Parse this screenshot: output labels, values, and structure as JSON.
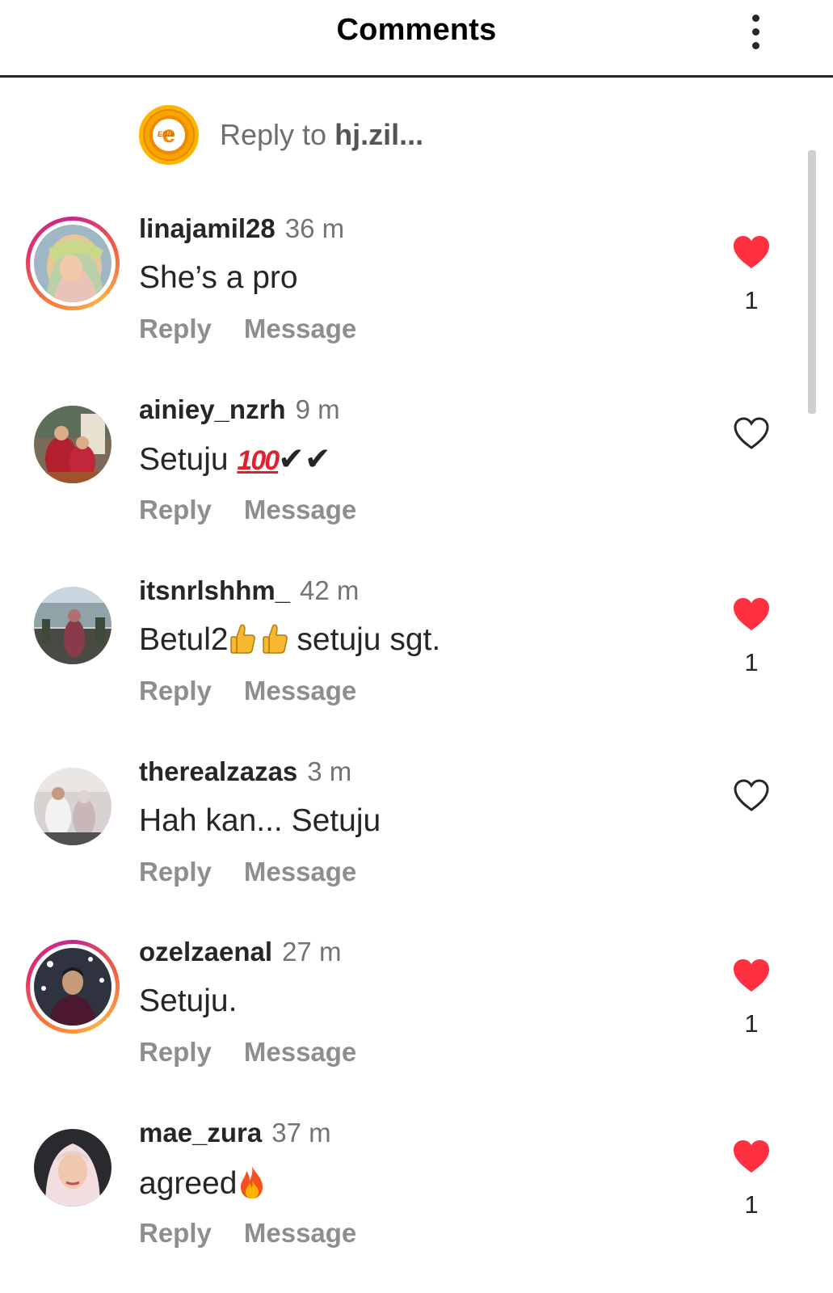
{
  "header": {
    "title": "Comments",
    "more_icon": "more-vertical-icon"
  },
  "reply_bar": {
    "prefix": "Reply to ",
    "username": "hj.zil...",
    "avatar_label": "EDtv"
  },
  "actions": {
    "reply": "Reply",
    "message": "Message"
  },
  "comments": [
    {
      "username": "linajamil28",
      "time": "36 m",
      "text": "She’s a pro",
      "liked": true,
      "like_count": "1",
      "story_ring": true
    },
    {
      "username": "ainiey_nzrh",
      "time": "9 m",
      "text_prefix": "Setuju ",
      "emoji_100": "100",
      "checks": "✔✔",
      "liked": false,
      "story_ring": false
    },
    {
      "username": "itsnrlshhm_",
      "time": "42 m",
      "text_prefix": "Betul2",
      "text_suffix": " setuju sgt.",
      "liked": true,
      "like_count": "1",
      "story_ring": false
    },
    {
      "username": "therealzazas",
      "time": "3 m",
      "text": "Hah kan... Setuju",
      "liked": false,
      "story_ring": false
    },
    {
      "username": "ozelzaenal",
      "time": "27 m",
      "text": "Setuju.",
      "liked": true,
      "like_count": "1",
      "story_ring": true
    },
    {
      "username": "mae_zura",
      "time": "37 m",
      "text_prefix": "agreed",
      "liked": true,
      "like_count": "1",
      "story_ring": false
    }
  ],
  "colors": {
    "heart_red": "#ff3040",
    "muted_text": "#8e8e8e"
  }
}
